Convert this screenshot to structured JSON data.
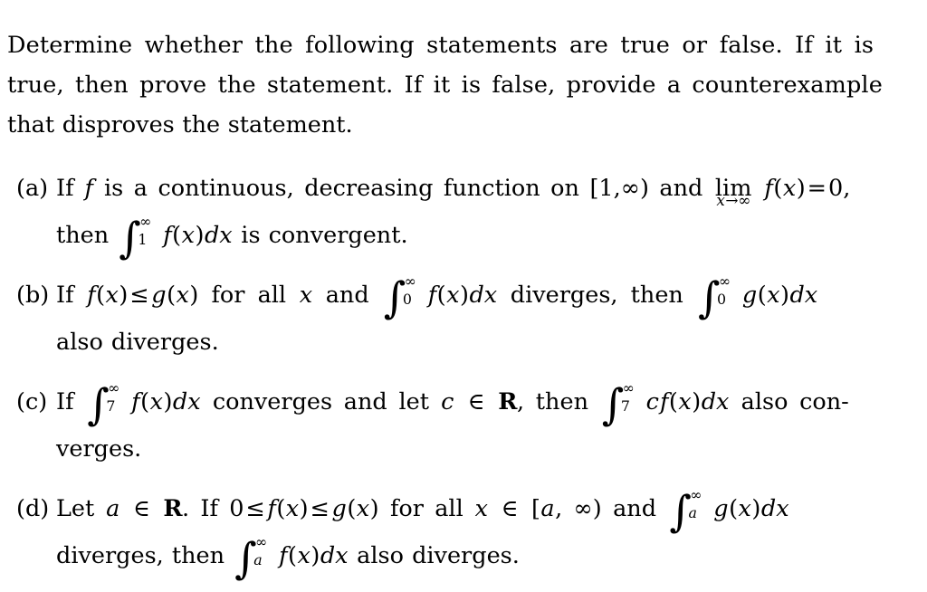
{
  "document": {
    "type": "math-problem-statement",
    "background_color": "#ffffff",
    "text_color": "#000000"
  },
  "intro": {
    "full_text": "Determine whether the following statements are true or false. If it is true, then prove the statement. If it is false, provide a counterexample that disproves the statement.",
    "lines": [
      "Determine whether the following statements are true or false. If it is",
      "true, then prove the statement. If it is false, provide a counterexample",
      "that disproves the statement."
    ]
  },
  "problems": {
    "items": [
      {
        "label": "(a)",
        "text_plain": "If f is a continuous, decreasing function on [1, ∞) and lim_{x→∞} f(x) = 0, then ∫_1^∞ f(x)dx is convergent.",
        "line1": {
          "seg1": "If",
          "f": "f",
          "seg2": "is a continuous, decreasing function on [1,",
          "infinity": "∞",
          "seg3": ") and",
          "lim": "lim",
          "lim_sub_var": "x",
          "lim_sub_arrow": "→∞",
          "fx": "f",
          "paren_open": "(",
          "var_x": "x",
          "paren_close": ")",
          "equals": "=",
          "zero": "0",
          "comma": ","
        },
        "line2": {
          "then": "then",
          "integral_lower": "1",
          "integral_upper": "∞",
          "integrand_f": "f",
          "integrand_paren_open": "(",
          "integrand_x": "x",
          "integrand_paren_close": ")",
          "dx": "dx",
          "tail": "is convergent."
        }
      },
      {
        "label": "(b)",
        "text_plain": "If f(x) ≤ g(x) for all x and ∫_0^∞ f(x)dx diverges, then ∫_0^∞ g(x)dx also diverges.",
        "line1": {
          "if": "If",
          "f": "f",
          "p1": "(",
          "x1": "x",
          "p2": ")",
          "leq": "≤",
          "g": "g",
          "p3": "(",
          "x2": "x",
          "p4": ")",
          "mid": "for all",
          "x3": "x",
          "and": "and",
          "int1_lower": "0",
          "int1_upper": "∞",
          "f2": "f",
          "p5": "(",
          "x4": "x",
          "p6": ")",
          "dx1": "dx",
          "diverges_then": "diverges, then",
          "int2_lower": "0",
          "int2_upper": "∞",
          "g2": "g",
          "p7": "(",
          "x5": "x",
          "p8": ")",
          "dx2": "dx"
        },
        "line2": {
          "text": "also diverges."
        }
      },
      {
        "label": "(c)",
        "text_plain": "If ∫_7^∞ f(x)dx converges and let c ∈ ℝ, then ∫_7^∞ cf(x)dx also converges.",
        "line1": {
          "if": "If",
          "int1_lower": "7",
          "int1_upper": "∞",
          "f": "f",
          "p1": "(",
          "x1": "x",
          "p2": ")",
          "dx1": "dx",
          "mid": "converges and let",
          "c1": "c",
          "in": "∈",
          "reals": "R",
          "comma_then": ", then",
          "int2_lower": "7",
          "int2_upper": "∞",
          "c2": "c",
          "f2": "f",
          "p3": "(",
          "x2": "x",
          "p4": ")",
          "dx2": "dx",
          "tail": "also con-"
        },
        "line2": {
          "text": "verges."
        }
      },
      {
        "label": "(d)",
        "text_plain": "Let a ∈ ℝ. If 0 ≤ f(x) ≤ g(x) for all x ∈ [a, ∞) and ∫_a^∞ g(x)dx diverges, then ∫_a^∞ f(x)dx also diverges.",
        "line1": {
          "let": "Let",
          "a1": "a",
          "in1": "∈",
          "reals": "R",
          "period_if": ". If",
          "zero": "0",
          "leq1": "≤",
          "f": "f",
          "p1": "(",
          "x1": "x",
          "p2": ")",
          "leq2": "≤",
          "g": "g",
          "p3": "(",
          "x2": "x",
          "p4": ")",
          "forall": "for all",
          "x3": "x",
          "in2": "∈",
          "bracket_open": "[",
          "a2": "a",
          "comma": ",",
          "infinity": "∞",
          "bracket_close": ")",
          "and": "and",
          "int1_lower": "a",
          "int1_upper": "∞",
          "g2": "g",
          "p5": "(",
          "x4": "x",
          "p6": ")",
          "dx1": "dx"
        },
        "line2": {
          "diverges_then": "diverges, then",
          "int2_lower": "a",
          "int2_upper": "∞",
          "f2": "f",
          "p7": "(",
          "x5": "x",
          "p8": ")",
          "dx2": "dx",
          "tail": "also diverges."
        }
      }
    ]
  }
}
